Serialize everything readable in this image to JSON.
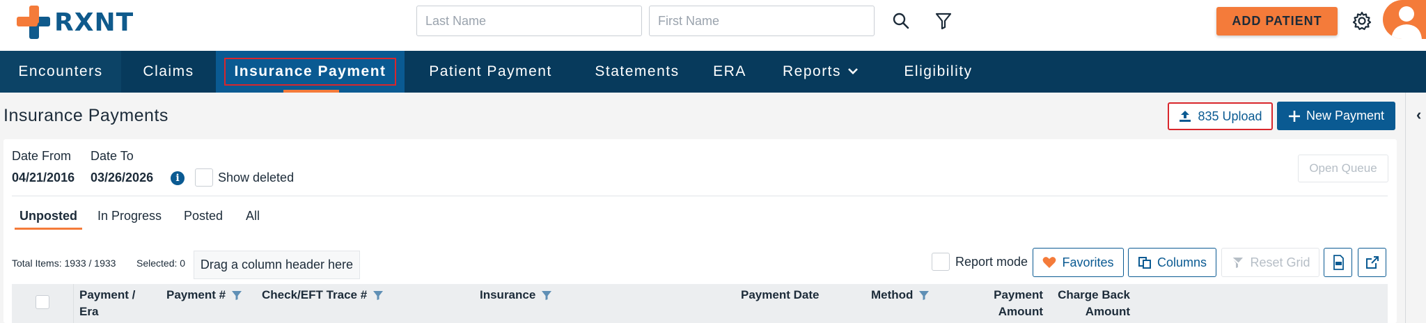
{
  "header": {
    "logo_text": "RXNT",
    "last_name_placeholder": "Last Name",
    "first_name_placeholder": "First Name",
    "add_patient_label": "ADD PATIENT"
  },
  "nav": {
    "items": [
      "Encounters",
      "Claims",
      "Insurance Payment",
      "Patient Payment",
      "Statements",
      "ERA",
      "Reports",
      "Eligibility"
    ],
    "active": "Insurance Payment"
  },
  "page": {
    "title": "Insurance Payments",
    "upload_label": "835 Upload",
    "new_payment_label": "New Payment"
  },
  "filters": {
    "date_from_label": "Date From",
    "date_from_value": "04/21/2016",
    "date_to_label": "Date To",
    "date_to_value": "03/26/2026",
    "show_deleted_label": "Show deleted",
    "open_queue_label": "Open Queue"
  },
  "tabs": [
    "Unposted",
    "In Progress",
    "Posted",
    "All"
  ],
  "active_tab": "Unposted",
  "grid": {
    "total_items": "Total Items: 1933 / 1933",
    "selected": "Selected: 0",
    "drag_hint": "Drag a column header here",
    "report_mode_label": "Report mode",
    "favorites_label": "Favorites",
    "columns_label": "Columns",
    "reset_grid_label": "Reset Grid",
    "columns": [
      {
        "line1": "Payment /",
        "line2": "Era"
      },
      {
        "line1": "Payment #",
        "line2": ""
      },
      {
        "line1": "Check/EFT Trace #",
        "line2": ""
      },
      {
        "line1": "Insurance",
        "line2": ""
      },
      {
        "line1": "Payment Date",
        "line2": ""
      },
      {
        "line1": "Method",
        "line2": ""
      },
      {
        "line1": "Payment",
        "line2": "Amount"
      },
      {
        "line1": "Charge Back",
        "line2": "Amount"
      }
    ]
  },
  "colors": {
    "brand_blue": "#0a5a92",
    "nav_bg": "#073a5c",
    "accent_orange": "#f47b3a",
    "highlight_red": "#d9262c"
  }
}
